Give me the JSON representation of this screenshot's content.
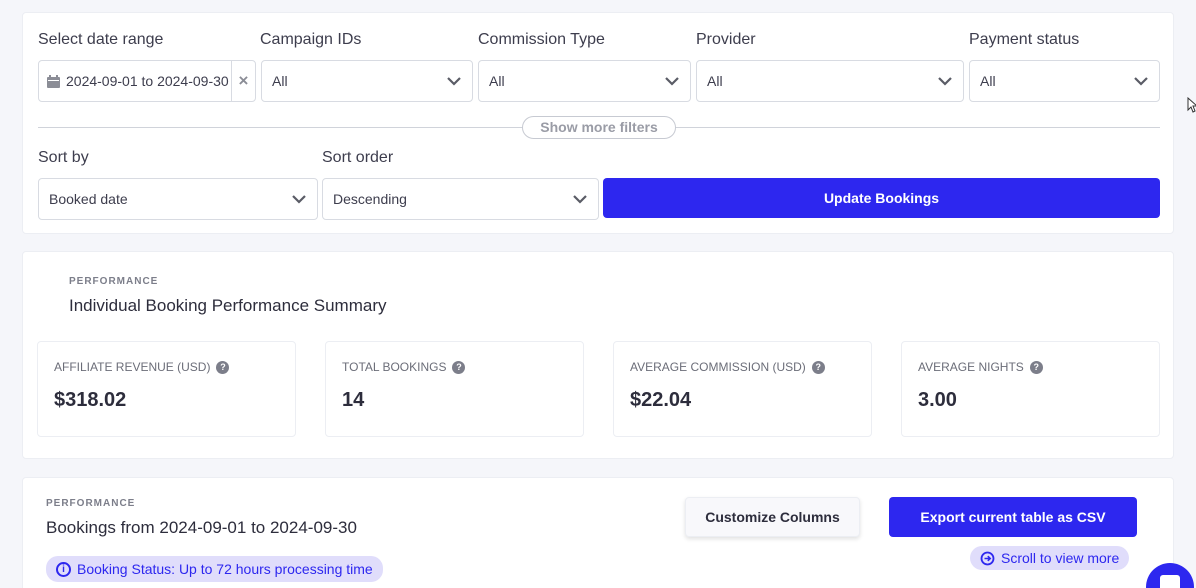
{
  "filters": {
    "date_range": {
      "label": "Select date range",
      "value": "2024-09-01 to 2024-09-30",
      "clear": "×"
    },
    "campaign_ids": {
      "label": "Campaign IDs",
      "value": "All"
    },
    "commission_type": {
      "label": "Commission Type",
      "value": "All"
    },
    "provider": {
      "label": "Provider",
      "value": "All"
    },
    "payment_status": {
      "label": "Payment status",
      "value": "All"
    },
    "show_more": "Show more filters",
    "sort_by": {
      "label": "Sort by",
      "value": "Booked date"
    },
    "sort_order": {
      "label": "Sort order",
      "value": "Descending"
    },
    "update_button": "Update Bookings"
  },
  "performance": {
    "eyebrow": "PERFORMANCE",
    "title": "Individual Booking Performance Summary",
    "stats": [
      {
        "label": "AFFILIATE REVENUE (USD)",
        "value": "$318.02"
      },
      {
        "label": "TOTAL BOOKINGS",
        "value": "14"
      },
      {
        "label": "AVERAGE COMMISSION (USD)",
        "value": "$22.04"
      },
      {
        "label": "AVERAGE NIGHTS",
        "value": "3.00"
      }
    ],
    "help_glyph": "?"
  },
  "bookings": {
    "eyebrow": "PERFORMANCE",
    "title": "Bookings from 2024-09-01 to 2024-09-30",
    "customize_button": "Customize Columns",
    "export_button": "Export current table as CSV",
    "scroll_hint": "Scroll to view more",
    "status_note": "Booking Status: Up to 72 hours processing time",
    "info_glyph": "i"
  },
  "colors": {
    "accent": "#2d27ef",
    "pill_bg": "#e0ddfb",
    "page_bg": "#f5f6fa"
  },
  "icons": [
    "calendar-icon",
    "clear-icon",
    "chevron-down-icon",
    "help-icon",
    "info-icon",
    "arrow-right-circle-icon",
    "chat-icon",
    "mouse-cursor-icon"
  ]
}
